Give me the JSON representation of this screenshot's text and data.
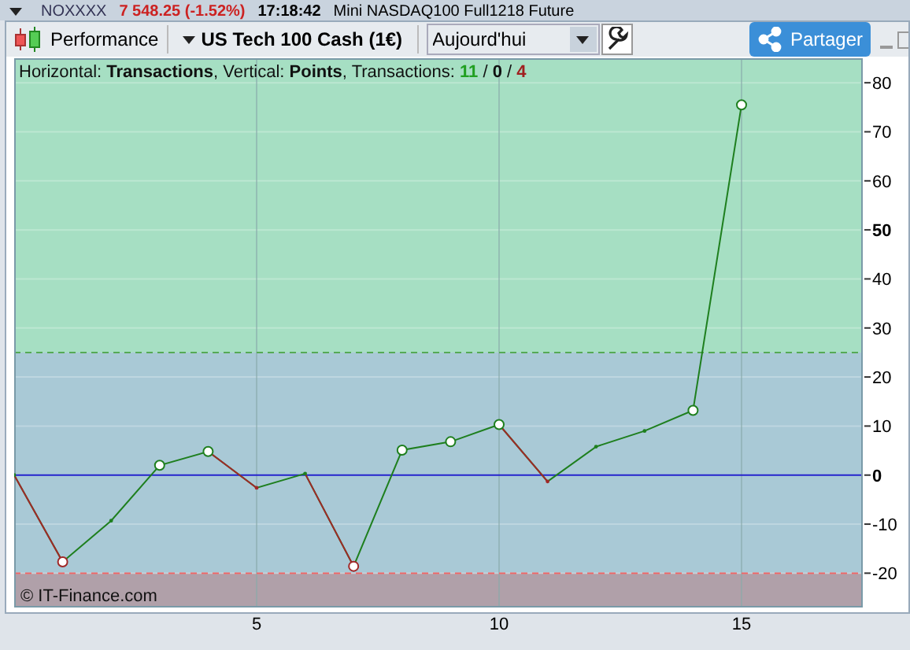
{
  "background_strip": {
    "symbol": "NOXXXX",
    "change": "7 548.25 (-1.52%)",
    "time": "17:18:42",
    "instrument": "Mini NASDAQ100 Full1218 Future"
  },
  "toolbar": {
    "title": "Performance",
    "instrument": "US Tech 100 Cash (1€)",
    "period": {
      "value": "Aujourd'hui"
    },
    "share_button": "Partager"
  },
  "chart": {
    "legend": "Horizontal: **Transactions**, Vertical: **Points**, Transactions: ",
    "counts": [
      {
        "text": "11",
        "color": "#22a022"
      },
      {
        "text": "0",
        "color": "#111111"
      },
      {
        "text": "4",
        "color": "#a02020"
      }
    ],
    "separator": " / ",
    "copyright": "© IT-Finance.com",
    "markers": [
      false,
      true,
      false,
      true,
      true,
      false,
      false,
      true,
      true,
      true,
      true,
      false,
      false,
      false,
      true,
      true
    ],
    "chart_data": {
      "type": "line",
      "x": [
        0,
        1,
        2,
        3,
        4,
        5,
        6,
        7,
        8,
        9,
        10,
        11,
        12,
        13,
        14,
        15
      ],
      "series": [
        {
          "color": "#1e7f1e",
          "values": [
            0,
            -17.7,
            -9.3,
            2,
            4.8,
            -2.6,
            0.3,
            -18.6,
            5.1,
            6.8,
            10.3,
            -1.3,
            5.8,
            9,
            13.2,
            75.5
          ]
        }
      ],
      "ref_lines": [
        {
          "axis": "y",
          "value": 25,
          "color": "#55aa55"
        },
        {
          "axis": "y",
          "value": -20,
          "color": "#ee6666"
        },
        {
          "axis": "y",
          "value": 0,
          "color": "#2222cc"
        }
      ],
      "grid": true,
      "xlim": [
        0,
        17.5
      ],
      "ylim": [
        -27,
        85
      ],
      "xticks": [
        5,
        10,
        15
      ],
      "yticks": [
        -20,
        -10,
        0,
        10,
        20,
        30,
        40,
        50,
        60,
        70,
        80
      ]
    }
  }
}
